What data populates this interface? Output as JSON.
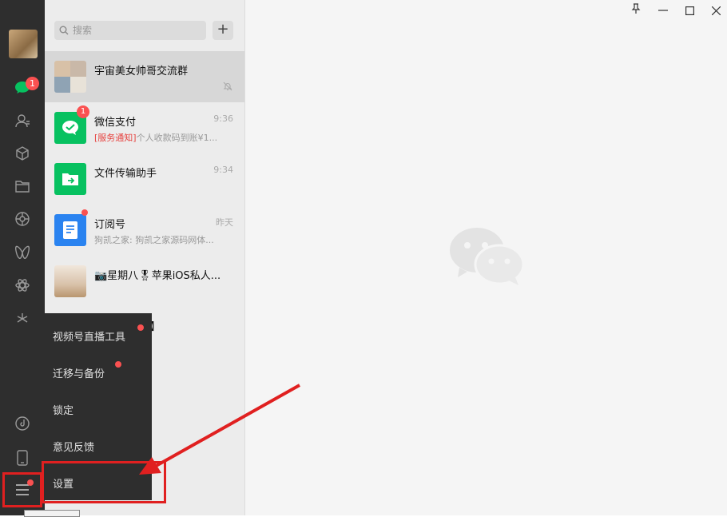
{
  "search": {
    "placeholder": "搜索"
  },
  "sidebar": {
    "chat_badge": "1"
  },
  "chats": [
    {
      "name": "宇宙美女帅哥交流群",
      "time": "",
      "preview": "",
      "muted": true
    },
    {
      "name": "微信支付",
      "time": "9:36",
      "preview_tag": "[服务通知]",
      "preview": "个人收款码到账¥1...",
      "badge": "1"
    },
    {
      "name": "文件传输助手",
      "time": "9:34",
      "preview": ""
    },
    {
      "name": "订阅号",
      "time": "昨天",
      "preview": "狗凯之家: 狗凯之家源码网体..."
    },
    {
      "name": "📷星期八🎖苹果iOS私人...",
      "time": "",
      "preview": ""
    },
    {
      "name": "】",
      "time": "",
      "preview": ""
    }
  ],
  "menu": {
    "items": [
      "视频号直播工具",
      "迁移与备份",
      "锁定",
      "意见反馈",
      "设置"
    ]
  },
  "colors": {
    "accent_green": "#07c160",
    "badge_red": "#fa5151",
    "highlight": "#e02020"
  }
}
